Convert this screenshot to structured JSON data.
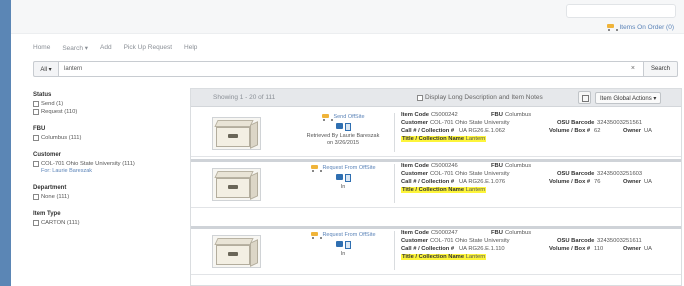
{
  "header": {
    "cart_label": "Items On Order (0)"
  },
  "nav": [
    "Home",
    "Search ▾",
    "Add",
    "Pick Up Request",
    "Help"
  ],
  "search": {
    "scope": "All ▾",
    "query": "lantern",
    "clear": "×",
    "button": "Search"
  },
  "facets": [
    {
      "title": "Status",
      "items": [
        {
          "label": "Send (1)"
        },
        {
          "label": "Request (110)"
        }
      ]
    },
    {
      "title": "FBU",
      "items": [
        {
          "label": "Columbus (111)"
        }
      ]
    },
    {
      "title": "Customer",
      "items": [
        {
          "label": "COL-701 Ohio State University (111)",
          "sub": "For: Laurie Bareszak"
        }
      ]
    },
    {
      "title": "Department",
      "items": [
        {
          "label": "None (111)"
        }
      ]
    },
    {
      "title": "Item Type",
      "items": [
        {
          "label": "CARTON (111)"
        }
      ]
    }
  ],
  "results_header": {
    "showing": "Showing 1 - 20 of 111",
    "long_desc": "Display Long Description and Item Notes",
    "actions": "Item Global Actions ▾"
  },
  "result_labels": {
    "item_code": "Item Code",
    "fbu": "FBU",
    "customer": "Customer",
    "osu_barcode": "OSU Barcode",
    "call": "Call # / Collection #",
    "volume": "Volume / Box #",
    "owner": "Owner",
    "title": "Title / Collection Name"
  },
  "results": [
    {
      "action": "Send OffSite",
      "status_lines": [
        "Retrieved By Laurie Bareszak",
        "on 3/26/2015"
      ],
      "item_code": "C5000242",
      "fbu": "Columbus",
      "customer": "COL-701 Ohio State University",
      "osu_barcode": "32435003251561",
      "call": "UA RG26.E.1.062",
      "volume": "62",
      "owner": "UA",
      "title": "Lantern"
    },
    {
      "action": "Request From OffSite",
      "status_lines": [
        "In"
      ],
      "item_code": "C5000246",
      "fbu": "Columbus",
      "customer": "COL-701 Ohio State University",
      "osu_barcode": "32435003251603",
      "call": "UA RG26.E.1.076",
      "volume": "76",
      "owner": "UA",
      "title": "Lantern"
    },
    {
      "action": "Request From OffSite",
      "status_lines": [
        "In"
      ],
      "item_code": "C5000247",
      "fbu": "Columbus",
      "customer": "COL-701 Ohio State University",
      "osu_barcode": "32435003251611",
      "call": "UA RG26.E.1.110",
      "volume": "110",
      "owner": "UA",
      "title": "Lantern"
    }
  ],
  "colors": {
    "accent_link": "#5a83b8",
    "highlight": "#fdf53b",
    "page_edge": "#5b86b5"
  }
}
